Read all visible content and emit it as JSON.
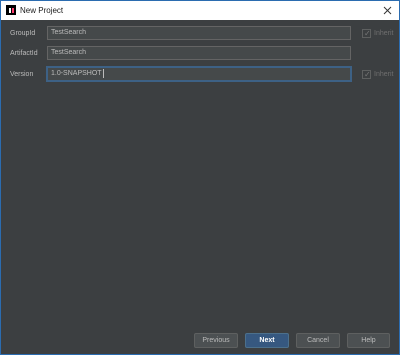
{
  "window": {
    "title": "New Project",
    "app_icon": "intellij-icon",
    "close_icon": "close-icon"
  },
  "form": {
    "group_id": {
      "label": "GroupId",
      "value": "TestSearch",
      "inherit_label": "Inherit",
      "inherit_checked": true,
      "inherit_enabled": false
    },
    "artifact_id": {
      "label": "ArtifactId",
      "value": "TestSearch"
    },
    "version": {
      "label": "Version",
      "value": "1.0-SNAPSHOT",
      "inherit_label": "Inherit",
      "inherit_checked": true,
      "inherit_enabled": false
    }
  },
  "buttons": {
    "previous": "Previous",
    "next": "Next",
    "cancel": "Cancel",
    "help": "Help"
  },
  "colors": {
    "background": "#3c3f41",
    "field_background": "#45494a",
    "primary_button": "#365880",
    "focus_border": "#3d6185"
  }
}
